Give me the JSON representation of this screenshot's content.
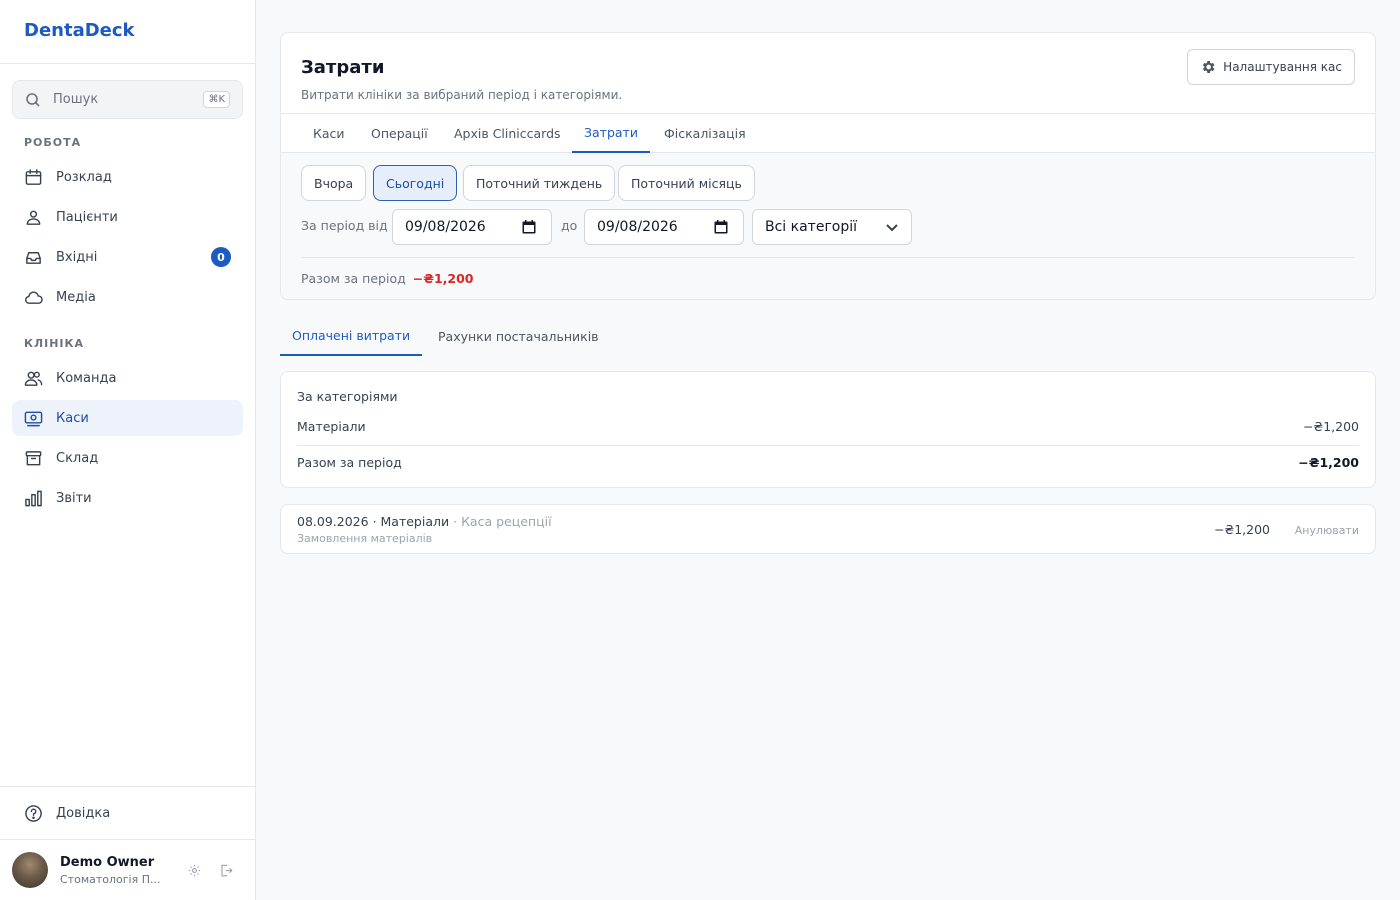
{
  "app": {
    "brand": "DentaDeck"
  },
  "sidebar": {
    "search_placeholder": "Пошук",
    "search_shortcut": "⌘K",
    "sections": {
      "work": "РОБОТА",
      "clinic": "КЛІНІКА"
    },
    "work_items": [
      {
        "label": "Розклад",
        "icon": "calendar-icon"
      },
      {
        "label": "Пацієнти",
        "icon": "users-icon"
      },
      {
        "label": "Вхідні",
        "icon": "inbox-icon",
        "badge": "0"
      },
      {
        "label": "Медіа",
        "icon": "cloud-icon"
      }
    ],
    "clinic_items": [
      {
        "label": "Команда",
        "icon": "team-icon"
      },
      {
        "label": "Каси",
        "icon": "cash-register-icon",
        "active": true
      },
      {
        "label": "Склад",
        "icon": "archive-icon"
      },
      {
        "label": "Звіти",
        "icon": "bar-chart-icon"
      }
    ],
    "help": "Довідка",
    "user": {
      "name": "Demo Owner",
      "org": "Стоматологія П..."
    }
  },
  "header": {
    "title": "Затрати",
    "subtitle": "Витрати клініки за вибраний період і категоріями.",
    "settings_button": "Налаштування кас"
  },
  "tabs": [
    "Каси",
    "Операції",
    "Архів Cliniccards",
    "Затрати",
    "Фіскалізація"
  ],
  "active_tab": "Затрати",
  "filters": {
    "quick": [
      "Вчора",
      "Сьогодні",
      "Поточний тиждень",
      "Поточний місяць"
    ],
    "quick_active": "Сьогодні",
    "period_from_label": "За період від",
    "period_to_label": "до",
    "date_from": "09/08/2026",
    "date_to": "09/08/2026",
    "category_select": "Всі категорії",
    "total_label": "Разом за період",
    "total_value": "−₴1,200",
    "negative_color": "#dc2626",
    "accent_color": "#1d5bc4"
  },
  "subtabs": [
    "Оплачені витрати",
    "Рахунки постачальників"
  ],
  "subtab_active": "Оплачені витрати",
  "by_category": {
    "title": "За категоріями",
    "rows": [
      {
        "name": "Матеріали",
        "amount": "−₴1,200"
      }
    ],
    "total_label": "Разом за період",
    "total_amount": "−₴1,200"
  },
  "expenses": [
    {
      "date": "08.09.2026",
      "category": "Матеріали",
      "register": "Каса рецепції",
      "note": "Замовлення матеріалів",
      "amount": "−₴1,200",
      "action": "Анулювати"
    }
  ]
}
